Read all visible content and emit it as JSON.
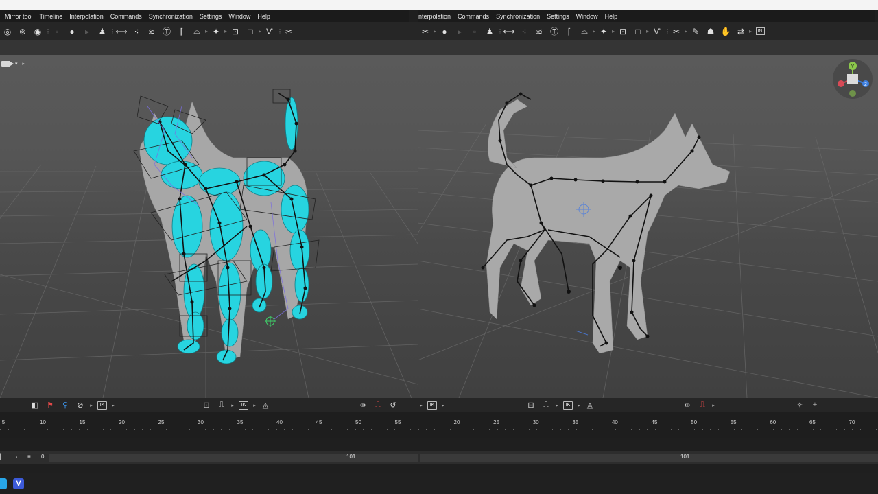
{
  "menu": {
    "left_items": [
      "e",
      "Mirror tool",
      "Timeline",
      "Interpolation",
      "Commands",
      "Synchronization",
      "Settings",
      "Window",
      "Help"
    ],
    "right_items": [
      "nterpolation",
      "Commands",
      "Synchronization",
      "Settings",
      "Window",
      "Help"
    ]
  },
  "toolbar": {
    "left_icons": [
      "spiral-icon",
      "double-spiral-icon",
      "key-dim-icon",
      "dot-icon",
      "person-icon",
      "line-tool-icon",
      "scatter-icon",
      "stack-icon",
      "text-tool-icon",
      "bracket-icon",
      "arch-icon",
      "runner-icon",
      "frame-icon",
      "square-icon",
      "v-shape-icon",
      "tangle-icon"
    ],
    "right_icons": [
      "tangle-icon",
      "dot-icon",
      "person-icon",
      "line-tool-icon",
      "scatter-icon",
      "stack-icon",
      "text-tool-icon",
      "bracket-icon",
      "arch-icon",
      "runner-icon",
      "frame-icon",
      "square-icon",
      "v-shape-icon",
      "tangle-icon",
      "paint-icon",
      "figure-icon",
      "grab-icon",
      "link-icon"
    ],
    "in_label": "IN"
  },
  "viewport": {
    "left_model": "cat-rig",
    "right_model": "dog-rig",
    "gizmo": {
      "y": "Y",
      "z": "Z"
    },
    "colors": {
      "cyan_bones": "#27d4e0",
      "skeleton": "#111111",
      "mesh": "#9e9e9e",
      "bg": "#4f4f4f"
    }
  },
  "bottombar": {
    "ik_label": "IK"
  },
  "timeline": {
    "left_ticks": [
      "5",
      "10",
      "15",
      "20",
      "25",
      "30",
      "35",
      "40",
      "45",
      "50",
      "55"
    ],
    "right_ticks": [
      "20",
      "25",
      "30",
      "35",
      "40",
      "45",
      "50",
      "55",
      "60",
      "65",
      "70"
    ]
  },
  "range": {
    "start": "0",
    "left_end": "101",
    "right_end": "101"
  },
  "taskbar": {
    "app_v_label": "V",
    "colors": {
      "app_v": "#3c5ad8",
      "app_left": "#28a6e8"
    }
  }
}
